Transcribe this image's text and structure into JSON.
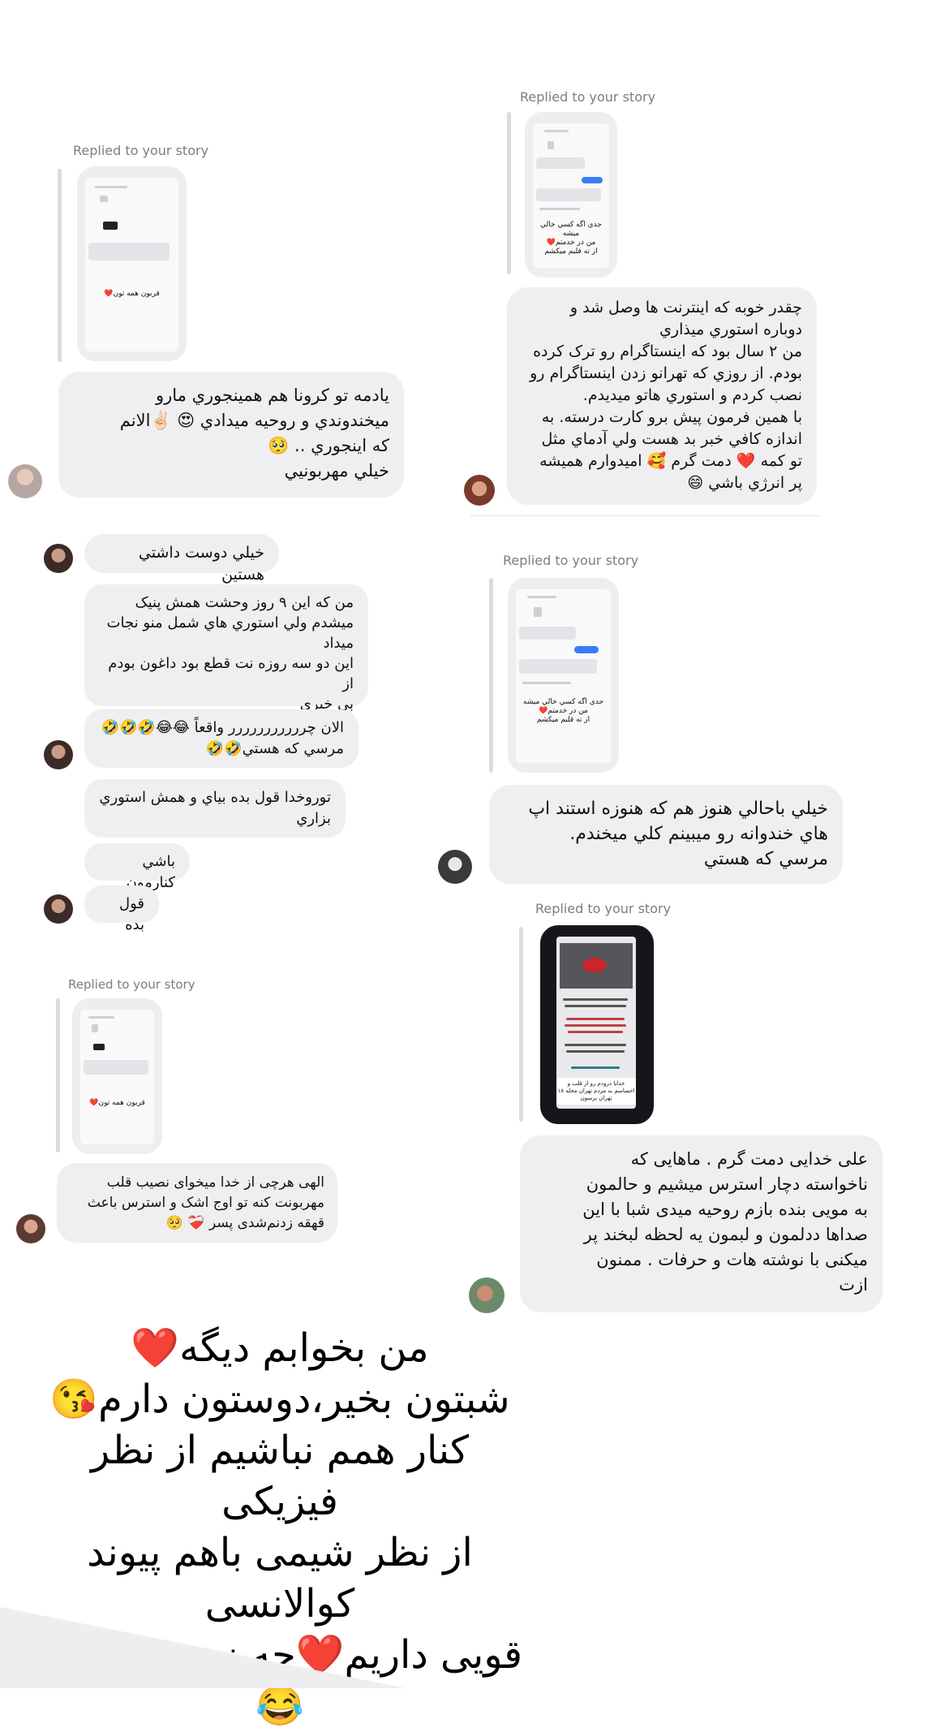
{
  "replied_label": "Replied to your story",
  "stories": {
    "col_left_1": {
      "caption": "قربون همه تون❤️"
    },
    "col_right_1": {
      "caption": "جدي اگه كسي خالي ميشه\nمن در خدمتم❤️\nاز ته قلبم ميكشم"
    },
    "col_right_2": {
      "caption": "جدي اگه كسي خالي ميشه\nمن در خدمتم❤️\nاز ته قلبم ميكشم"
    },
    "col_left_2": {
      "caption": "قربون همه تون❤️"
    },
    "col_right_3": {
      "caption": "خدايا درودم رو از قلب و احساسم به مردم تهران محله ۱۸ تهران برسون"
    }
  },
  "messages": {
    "left_a": "يادمه تو كرونا هم همينجوري مارو\nميخندوندي و روحيه ميدادي 😍 ✌🏻الانم\nكه اينجوري .. 🥺\nخيلي مهربونيي",
    "right_a": "چقدر خوبه كه اينترنت ها وصل شد و\nدوباره استوري ميذاري\nمن ۲ سال بود كه اينستاگرام رو ترک كرده\nبودم. از روزي كه تهرانو زدن اينستاگرام رو\nنصب كردم و استوري هاتو ميديدم.\nبا همين فرمون پيش برو كارت درسته. به\nاندازه كافي خبر بد هست ولي آدماي مثل\nتو كمه ❤️ دمت گرم 🥰 اميدوارم هميشه\nپر انرژي باشي 😄",
    "thread_1": "خيلي دوست داشتي هستين",
    "thread_2": "من كه اين ۹ روز  وحشت همش پنيک\nميشدم ولي استوري هاي شمل منو نجات\nميداد\nاين دو سه روزه نت قطع بود داغون بودم از\nبي خبري",
    "thread_3": "الان چررررررررررر واقعاً 😂😂🤣🤣🤣\nمرسي كه هستي🤣🤣",
    "thread_4": "توروخدا قول بده بياي و همش استوري\nبزاري",
    "thread_5": "باشي كنارمون",
    "thread_6": "قول بده",
    "right_b": "خيلي باحالي هنوز هم كه هنوزه استند اپ\nهاي خندوانه رو ميبينم كلي ميخندم.\nمرسي كه هستي",
    "left_b": "الهی هرچی از خدا میخوای نصیب قلب\nمهربونت کنه تو اوج اشک و استرس باعث\nقهقه زدنم‌شدی پسر ❤️‍🩹 🥺",
    "right_c": "علی خدایی دمت گرم . ماهایی که\nناخواسته دچار استرس میشیم  و حالمون\nبه مویی بنده بازم روحیه میدی شبا با این\nصداها ددلمون و لبمون یه لحظه لبخند پر\nمیکنی با نوشته هات و حرفات . ممنون\nازت"
  },
  "closing_note": "من بخوابم ديگه❤️\nشبتون بخير،دوستون دارم😘\nكنار همم نباشيم از نظر فيزيكی\nاز نظر شيمی باهم پيوند كوالانسی\nقويی داريم❤️چه زری بود زدم😂"
}
